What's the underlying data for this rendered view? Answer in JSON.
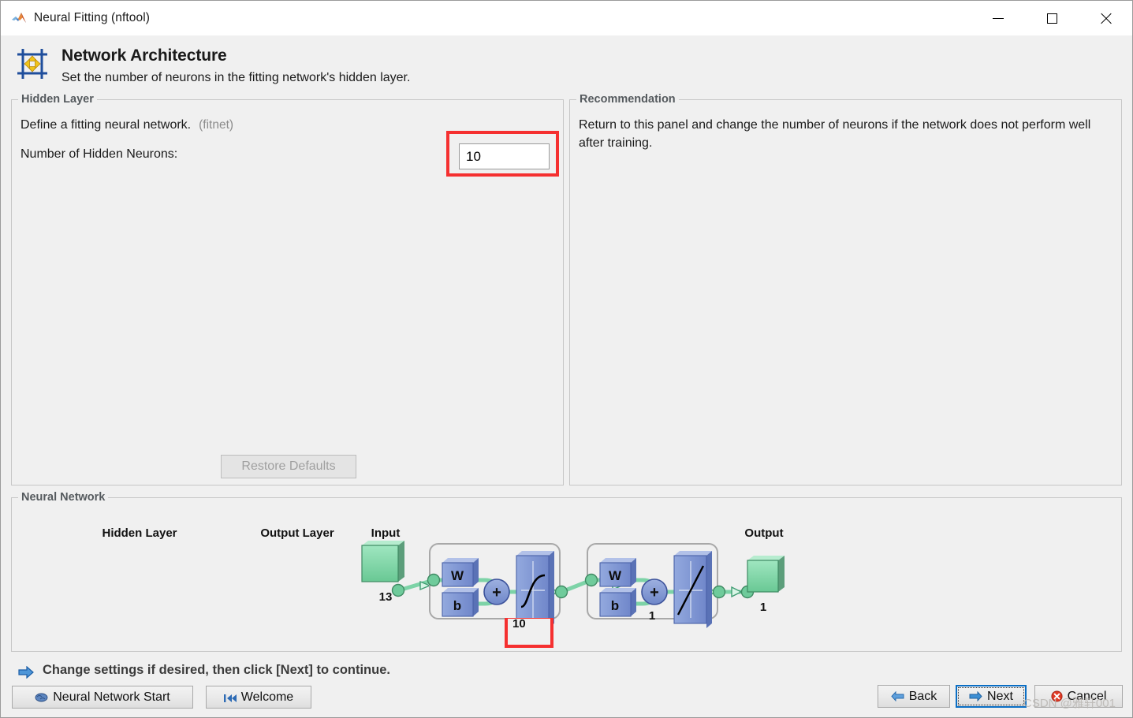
{
  "window": {
    "title": "Neural Fitting (nftool)",
    "app_icon": "matlab-membrane-icon",
    "minimize_label": "Minimize",
    "maximize_label": "Maximize",
    "close_label": "Close"
  },
  "header": {
    "icon": "network-architecture-icon",
    "title": "Network Architecture",
    "subtitle": "Set the number of neurons in the fitting network's hidden layer."
  },
  "hidden_layer_panel": {
    "group_title": "Hidden Layer",
    "define_label": "Define a fitting neural network.",
    "define_hint": "(fitnet)",
    "neurons_label": "Number of Hidden Neurons:",
    "neurons_value": "10",
    "neurons_placeholder": "10",
    "restore_defaults_label": "Restore Defaults",
    "restore_defaults_enabled": false,
    "highlight_color": "#f53030"
  },
  "recommendation_panel": {
    "group_title": "Recommendation",
    "text": "Return to this panel and change the number of neurons if the network does not perform well after training."
  },
  "neural_network_panel": {
    "group_title": "Neural Network",
    "diagram": {
      "input_label": "Input",
      "input_size": "13",
      "hidden_layer_label": "Hidden Layer",
      "hidden_layer_size": "10",
      "output_layer_label": "Output Layer",
      "output_layer_size": "1",
      "output_label": "Output",
      "output_size": "1",
      "weight_symbol": "W",
      "bias_symbol": "b",
      "sum_symbol": "+",
      "hidden_transfer": "tansig-sigmoid-icon",
      "output_transfer": "purelin-linear-icon",
      "block_color": "#7a93d4",
      "io_color": "#7fd9a8",
      "link_color": "#8ad6ae"
    }
  },
  "status": {
    "icon": "right-arrow-icon",
    "text": "Change settings  if desired, then click [Next] to continue."
  },
  "bottom_buttons": {
    "neural_network_start": "Neural Network Start",
    "neural_network_start_icon": "brain-icon",
    "welcome": "Welcome",
    "welcome_icon": "skip-to-start-icon",
    "back": "Back",
    "back_icon": "left-arrow-icon",
    "next": "Next",
    "next_icon": "right-arrow-icon",
    "cancel": "Cancel",
    "cancel_icon": "error-x-icon"
  },
  "watermark": {
    "text": "CSDN @雅轩001"
  }
}
